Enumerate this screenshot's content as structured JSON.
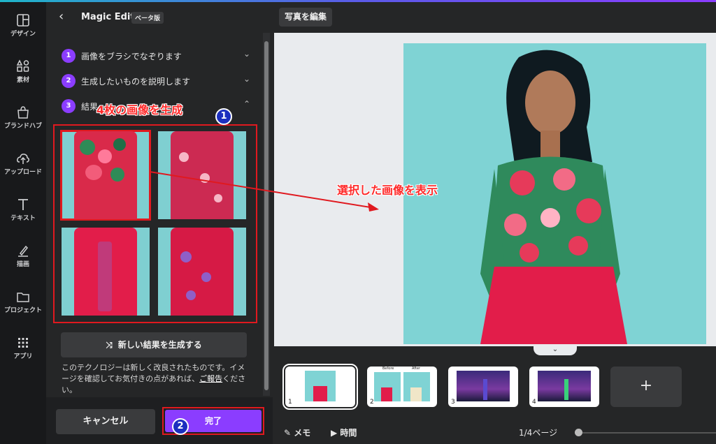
{
  "rail": {
    "items": [
      {
        "label": "デザイン",
        "icon": "layout-icon"
      },
      {
        "label": "素材",
        "icon": "shapes-icon"
      },
      {
        "label": "ブランドハブ",
        "icon": "brand-icon"
      },
      {
        "label": "アップロード",
        "icon": "cloud-upload-icon"
      },
      {
        "label": "テキスト",
        "icon": "text-icon"
      },
      {
        "label": "描画",
        "icon": "draw-icon"
      },
      {
        "label": "プロジェクト",
        "icon": "folder-icon"
      },
      {
        "label": "アプリ",
        "icon": "apps-icon"
      }
    ]
  },
  "panel": {
    "back_icon": "‹",
    "title": "Magic Edit",
    "badge": "ベータ版",
    "steps": [
      {
        "num": "1",
        "label": "画像をブラシでなぞります"
      },
      {
        "num": "2",
        "label": "生成したいものを説明します"
      },
      {
        "num": "3",
        "label": "結果"
      }
    ],
    "regen_label": "新しい結果を生成する",
    "note_text": "このテクノロジーは新しく改良されたものです。イメージを確認してお気付きの点があれば、",
    "note_link": "ご報告",
    "note_tail": "ください。",
    "cancel_label": "キャンセル",
    "done_label": "完了"
  },
  "annotations": {
    "generate_label": "4枚の画像を生成",
    "badge1": "1",
    "select_label": "選択した画像を表示",
    "badge2": "2"
  },
  "main": {
    "edit_photo_label": "写真を編集",
    "collapse_icon": "⌄",
    "pages": [
      {
        "num": "1"
      },
      {
        "num": "2"
      },
      {
        "num": "3"
      },
      {
        "num": "4"
      }
    ],
    "page2_before": "Before",
    "page2_after": "After",
    "add_page_icon": "+",
    "memo_label": "メモ",
    "time_label": "時間",
    "page_indicator": "1/4ページ"
  },
  "colors": {
    "accent": "#8b3dff",
    "annotation_red": "#e0191f",
    "photo_bg": "#7fd3d4",
    "dress_red": "#e21d4a"
  }
}
